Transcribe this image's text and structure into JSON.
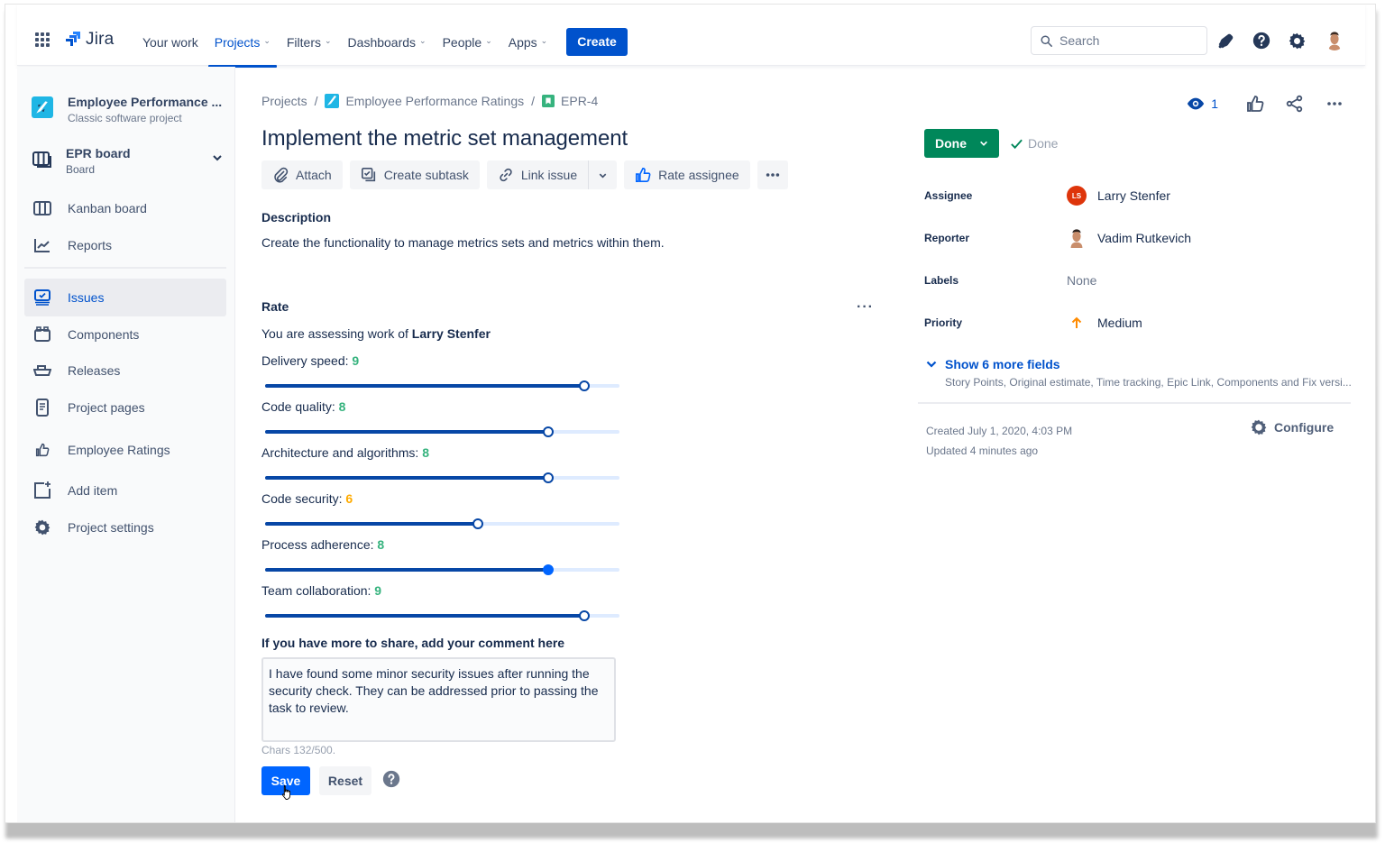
{
  "topnav": {
    "product": "Jira",
    "items": [
      {
        "label": "Your work",
        "has_dropdown": false,
        "active": false
      },
      {
        "label": "Projects",
        "has_dropdown": true,
        "active": true
      },
      {
        "label": "Filters",
        "has_dropdown": true,
        "active": false
      },
      {
        "label": "Dashboards",
        "has_dropdown": true,
        "active": false
      },
      {
        "label": "People",
        "has_dropdown": true,
        "active": false
      },
      {
        "label": "Apps",
        "has_dropdown": true,
        "active": false
      }
    ],
    "create_label": "Create",
    "search_placeholder": "Search",
    "icons": [
      "notifications-icon",
      "help-icon",
      "settings-icon",
      "profile-avatar"
    ]
  },
  "sidebar": {
    "project_name": "Employee Performance ...",
    "project_type": "Classic software project",
    "board_title": "EPR board",
    "board_sub": "Board",
    "items_top": [
      {
        "label": "Kanban board",
        "icon": "kanban-icon"
      },
      {
        "label": "Reports",
        "icon": "reports-icon"
      }
    ],
    "items": [
      {
        "label": "Issues",
        "icon": "issues-icon",
        "active": true
      },
      {
        "label": "Components",
        "icon": "components-icon",
        "active": false
      },
      {
        "label": "Releases",
        "icon": "releases-icon",
        "active": false
      },
      {
        "label": "Project pages",
        "icon": "project-pages-icon",
        "active": false
      },
      {
        "label": "Employee Ratings",
        "icon": "thumbs-up-icon",
        "active": false
      },
      {
        "label": "Add item",
        "icon": "add-item-icon",
        "active": false
      },
      {
        "label": "Project settings",
        "icon": "settings-icon",
        "active": false
      }
    ]
  },
  "issue": {
    "breadcrumb": [
      "Projects",
      "Employee Performance Ratings",
      "EPR-4"
    ],
    "title": "Implement the metric set management",
    "toolbar": {
      "attach": "Attach",
      "create_subtask": "Create subtask",
      "link_issue": "Link issue",
      "rate_assignee": "Rate assignee"
    },
    "description_heading": "Description",
    "description": "Create the functionality to manage metrics sets and metrics within them."
  },
  "rate": {
    "heading": "Rate",
    "assessing_prefix": "You are assessing work of ",
    "assessee": "Larry Stenfer",
    "scale_max": 10,
    "metrics": [
      {
        "label": "Delivery speed:",
        "value": 9,
        "color": "#36B37E",
        "focused": false
      },
      {
        "label": "Code quality:",
        "value": 8,
        "color": "#36B37E",
        "focused": false
      },
      {
        "label": "Architecture and algorithms:",
        "value": 8,
        "color": "#36B37E",
        "focused": false
      },
      {
        "label": "Code security:",
        "value": 6,
        "color": "#FFAB00",
        "focused": false
      },
      {
        "label": "Process adherence:",
        "value": 8,
        "color": "#36B37E",
        "focused": true
      },
      {
        "label": "Team collaboration:",
        "value": 9,
        "color": "#36B37E",
        "focused": false
      }
    ],
    "comment_heading": "If you have more to share, add your comment here",
    "comment_value": "I have found some minor security issues after running the security check. They can be addressed prior to passing the task to review.",
    "chars": "Chars 132/500.",
    "save_label": "Save",
    "reset_label": "Reset"
  },
  "details": {
    "watchers": "1",
    "status_label": "Done",
    "resolution": "Done",
    "fields": [
      {
        "label": "Assignee",
        "value": "Larry Stenfer",
        "avatar": "LS"
      },
      {
        "label": "Reporter",
        "value": "Vadim Rutkevich"
      },
      {
        "label": "Labels",
        "value": "None"
      },
      {
        "label": "Priority",
        "value": "Medium"
      }
    ],
    "show_more": "Show 6 more fields",
    "show_more_sub": "Story Points, Original estimate, Time tracking, Epic Link, Components and Fix versi...",
    "created": "Created July 1, 2020, 4:03 PM",
    "updated": "Updated 4 minutes ago",
    "configure": "Configure"
  },
  "colors": {
    "brand": "#0052CC",
    "status_done": "#00875A",
    "priority_medium": "#FF8B00",
    "assignee_avatar": "#DE350B"
  }
}
